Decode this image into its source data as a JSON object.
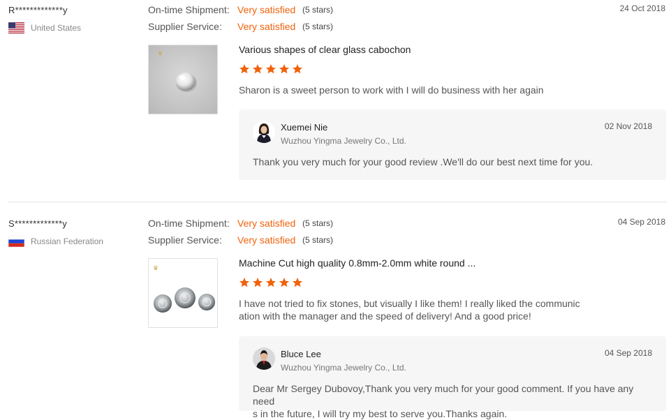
{
  "colors": {
    "accent": "#f0620c",
    "star": "#f0620c",
    "reply_bg": "#f6f6f6"
  },
  "reviews": [
    {
      "buyer": "R*************y",
      "country": "United States",
      "flag_icon": "us-flag-icon",
      "shipment_label": "On-time Shipment:",
      "shipment_value": "Very satisfied",
      "shipment_stars": "(5 stars)",
      "service_label": "Supplier Service:",
      "service_value": "Very satisfied",
      "service_stars": "(5 stars)",
      "date": "24 Oct 2018",
      "product_title": "Various shapes of clear glass cabochon",
      "rating": 5,
      "comment": "Sharon is a sweet person to work with I will do business with her again",
      "reply": {
        "seller": "Xuemei Nie",
        "company": "Wuzhou Yingma Jewelry Co., Ltd.",
        "date": "02 Nov 2018",
        "text": "Thank you very much for your good review .We'll do our best next time for you."
      }
    },
    {
      "buyer": "S*************y",
      "country": "Russian Federation",
      "flag_icon": "russia-flag-icon",
      "shipment_label": "On-time Shipment:",
      "shipment_value": "Very satisfied",
      "shipment_stars": "(5 stars)",
      "service_label": "Supplier Service:",
      "service_value": "Very satisfied",
      "service_stars": "(5 stars)",
      "date": "04 Sep 2018",
      "product_title": "Machine Cut high quality 0.8mm-2.0mm white round ...",
      "rating": 5,
      "comment": "I have not tried to fix stones, but visually I like them! I really liked the communic\nation with the manager and the speed of delivery! And a good price!",
      "reply": {
        "seller": "Bluce Lee",
        "company": "Wuzhou Yingma Jewelry Co., Ltd.",
        "date": "04 Sep 2018",
        "text": "Dear Mr Sergey Dubovoy,Thank you very much for your good comment. If you have any need\ns in the future, I will try my best to serve you.Thanks again."
      }
    }
  ]
}
